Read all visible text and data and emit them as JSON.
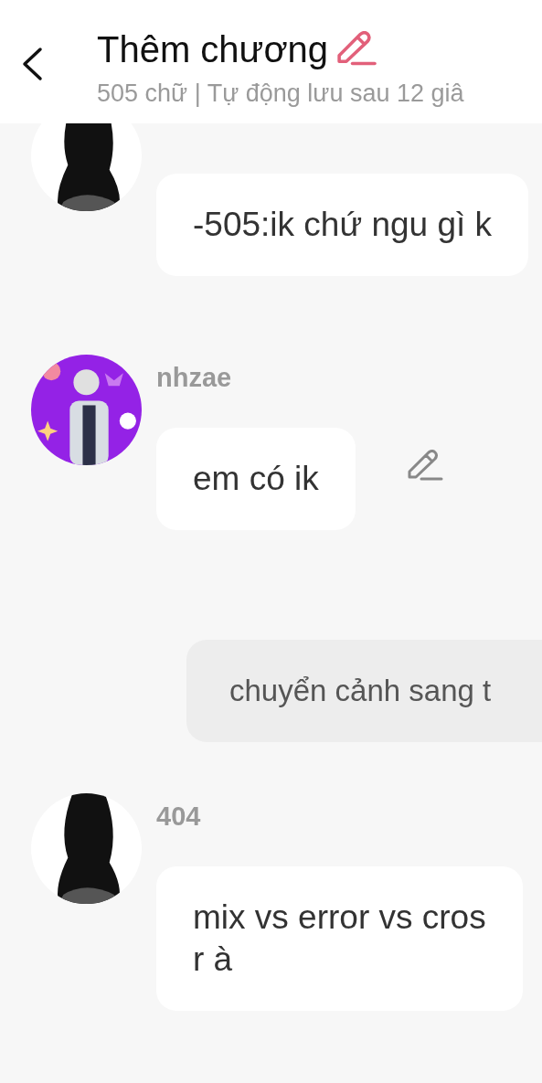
{
  "header": {
    "title": "Thêm chương",
    "subtitle": "505 chữ | Tự động lưu sau 12 giâ"
  },
  "messages": [
    {
      "kind": "message",
      "text": "-505:ik chứ ngu gì k",
      "show_edit": false
    },
    {
      "kind": "message",
      "name": "nhzae",
      "text": "em có ik",
      "show_edit": true
    },
    {
      "kind": "narration",
      "text": "chuyển cảnh sang t"
    },
    {
      "kind": "message",
      "name": "404",
      "text": "mix vs error vs cros\nr à",
      "show_edit": false
    }
  ]
}
